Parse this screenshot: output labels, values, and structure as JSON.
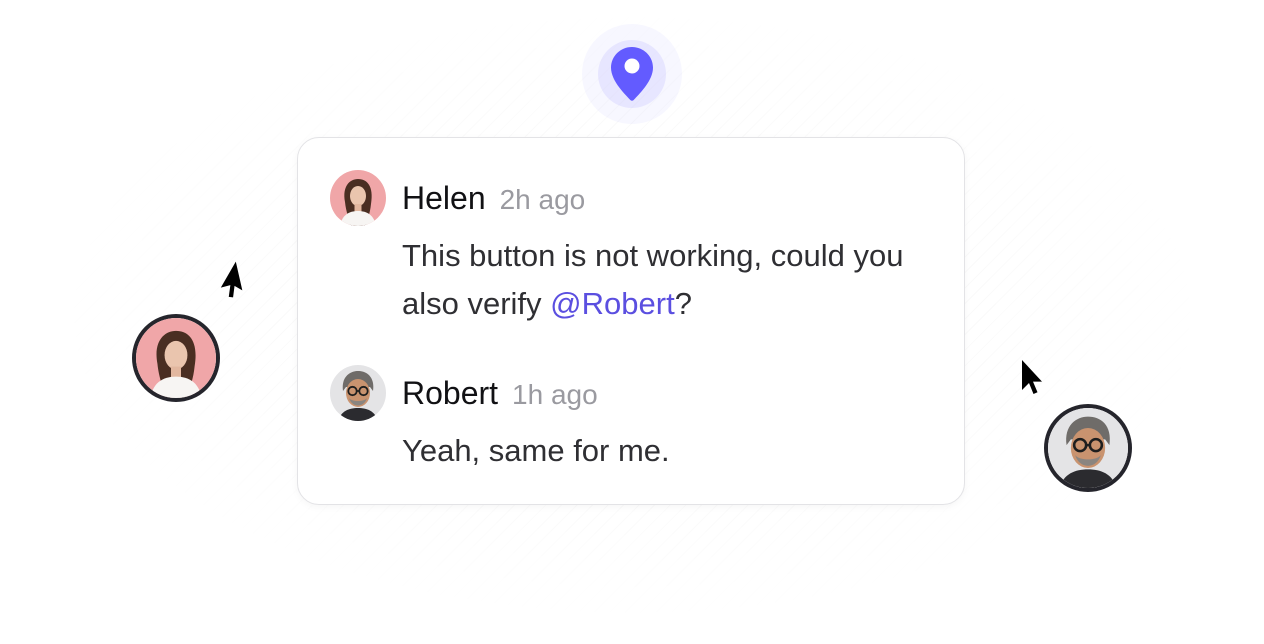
{
  "comments": [
    {
      "author": "Helen",
      "time": "2h ago",
      "text_before": "This button is not working, could you also verify ",
      "mention": "@Robert",
      "text_after": "?",
      "avatar_bg": "#f0a6a8"
    },
    {
      "author": "Robert",
      "time": "1h ago",
      "text": "Yeah, same for me.",
      "avatar_bg": "#e4e4e6"
    }
  ],
  "icons": {
    "location_pin": "map-pin-icon",
    "cursor": "mouse-pointer-icon"
  },
  "colors": {
    "accent": "#635bff",
    "mention": "#5b4fe0",
    "avatar_ring": "#25252c"
  }
}
